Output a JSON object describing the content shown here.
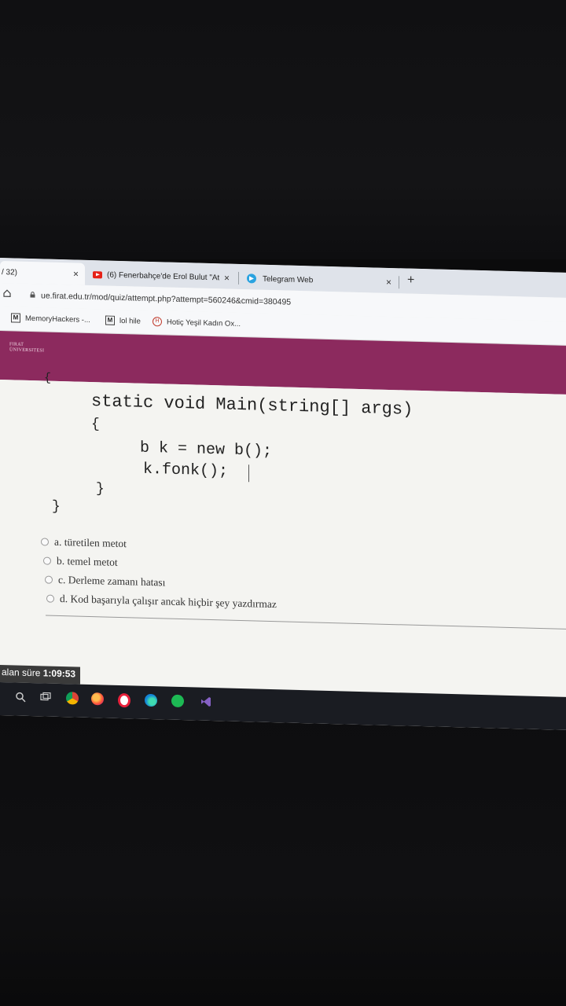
{
  "browser": {
    "tabs": [
      {
        "title": "/ 32)",
        "active": true
      },
      {
        "title": "(6) Fenerbahçe'de Erol Bulut \"At",
        "active": false
      },
      {
        "title": "Telegram Web",
        "active": false
      }
    ],
    "close_glyph": "×",
    "new_tab_glyph": "+",
    "url": "ue.firat.edu.tr/mod/quiz/attempt.php?attempt=560246&cmid=380495",
    "bookmarks": [
      {
        "icon": "M",
        "label": "MemoryHackers -..."
      },
      {
        "icon": "M",
        "label": "lol hile"
      },
      {
        "icon": "H",
        "label": "Hotiç Yeşil Kadın Ox..."
      }
    ]
  },
  "site": {
    "logo_line1": "FIRAT",
    "logo_line2": "ÜNIVERSITESI"
  },
  "question": {
    "code_lines": [
      "{",
      "static void Main(string[] args)",
      "{",
      "b k = new b();",
      "k.fonk();",
      "}",
      "}"
    ],
    "answers": [
      "a. türetilen metot",
      "b. temel metot",
      "c. Derleme zamanı hatası",
      "d. Kod başarıyla çalışır ancak hiçbir şey yazdırmaz"
    ]
  },
  "timer": {
    "label": "alan süre",
    "value": "1:09:53"
  },
  "taskbar": {
    "icons": [
      "search-icon",
      "task-view-icon",
      "chrome-icon",
      "firefox-icon",
      "opera-icon",
      "edge-icon",
      "spotify-icon",
      "visual-studio-icon"
    ]
  }
}
